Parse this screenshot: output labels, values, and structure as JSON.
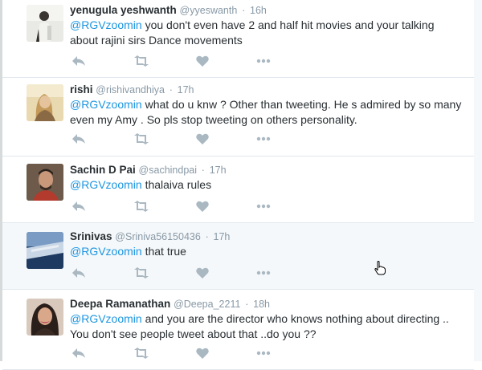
{
  "tweets": [
    {
      "name": "yenugula yeshwanth",
      "handle": "@yyeswanth",
      "separator": "·",
      "time": "16h",
      "mention": "@RGVzoomin",
      "text": " you don't even have 2 and half hit movies and your talking about rajini sirs Dance movements",
      "avatar_icon": "user-photo-avatar"
    },
    {
      "name": "rishi",
      "handle": "@rishivandhiya",
      "separator": "·",
      "time": "17h",
      "mention": "@RGVzoomin",
      "text": "  what do u knw ? Other than tweeting. He s admired by so many even my Amy . So pls stop tweeting on others personality.",
      "avatar_icon": "user-photo-avatar"
    },
    {
      "name": "Sachin D Pai",
      "handle": "@sachindpai",
      "separator": "·",
      "time": "17h",
      "mention": "@RGVzoomin",
      "text": " thalaiva rules",
      "avatar_icon": "user-photo-avatar"
    },
    {
      "name": "Srinivas",
      "handle": "@Sriniva56150436",
      "separator": "·",
      "time": "17h",
      "mention": "@RGVzoomin",
      "text": " that true",
      "avatar_icon": "user-photo-avatar"
    },
    {
      "name": "Deepa Ramanathan",
      "handle": "@Deepa_2211",
      "separator": "·",
      "time": "18h",
      "mention": "@RGVzoomin",
      "text": " and you are the director who knows nothing about directing .. You don't see people tweet about that ..do you ??",
      "avatar_icon": "user-photo-avatar"
    }
  ],
  "action_icons": [
    "reply-icon",
    "retweet-icon",
    "like-icon",
    "more-icon"
  ],
  "colors": {
    "mention": "#1b95e0",
    "muted": "#8899a6",
    "text": "#292f33",
    "divider": "#e1e8ed",
    "hover_bg": "#f5f8fa",
    "icon": "#aab8c2"
  }
}
